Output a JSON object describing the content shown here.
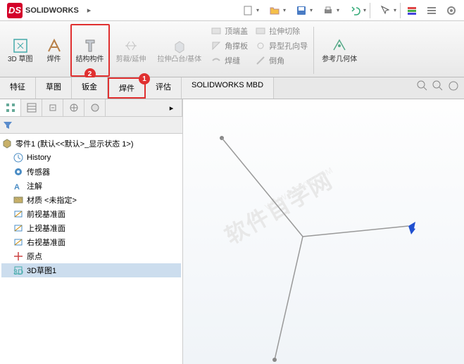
{
  "app": {
    "name": "SOLIDWORKS",
    "logo_text": "DS"
  },
  "ribbon": {
    "sketch3d": "3D 草图",
    "weldment": "焊件",
    "structural": "结构构件",
    "trim": "剪裁/延伸",
    "extrude": "拉伸凸台/基体",
    "endcap": "顶端盖",
    "gusset": "角撑板",
    "weldbead": "焊缝",
    "extruded_cut": "拉伸切除",
    "hole_wizard": "异型孔向导",
    "chamfer": "倒角",
    "ref_geom": "参考几何体"
  },
  "tabs": {
    "features": "特征",
    "sketch": "草图",
    "sheetmetal": "钣金",
    "weldments": "焊件",
    "evaluate": "评估",
    "mbd": "SOLIDWORKS MBD"
  },
  "badges": {
    "b1": "1",
    "b2": "2"
  },
  "tree": {
    "root": "零件1 (默认<<默认>_显示状态 1>)",
    "history": "History",
    "sensors": "传感器",
    "annotations": "注解",
    "material": "材质 <未指定>",
    "front": "前视基准面",
    "top": "上视基准面",
    "right": "右视基准面",
    "origin": "原点",
    "sketch3d1": "3D草图1"
  },
  "watermark": {
    "text": "软件自学网",
    "url": "WWW.RJZXW.COM"
  }
}
